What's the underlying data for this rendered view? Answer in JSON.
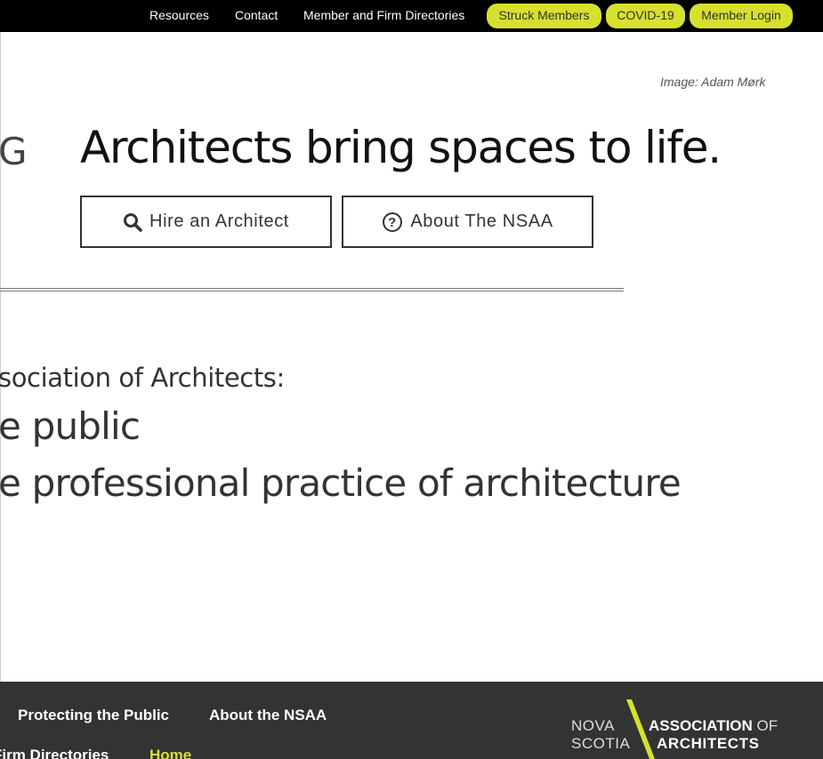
{
  "top_nav": {
    "links": [
      "Resources",
      "Contact",
      "Member and Firm Directories"
    ],
    "pills": [
      "Struck Members",
      "COVID-19",
      "Member Login"
    ]
  },
  "hero": {
    "image_credit": "Image: Adam Mørk",
    "clipped_letter": "G",
    "headline": "Architects bring spaces to life.",
    "buttons": {
      "hire": "Hire an Architect",
      "about": "About The NSAA"
    }
  },
  "mission": {
    "intro": "sociation of Architects:",
    "line1": "e public",
    "line2": "e professional practice of architecture"
  },
  "footer": {
    "nav_row1": [
      "Protecting the Public",
      "About the NSAA"
    ],
    "nav_row2": [
      "Firm Directories",
      "Home"
    ],
    "logo": {
      "nova": "NOVA",
      "scotia": "SCOTIA",
      "association": "ASSOCIATION",
      "of": "OF",
      "architects": "ARCHITECTS"
    }
  },
  "colors": {
    "accent": "#d6e02e",
    "topbar": "#000000",
    "footer": "#333333"
  },
  "icons": [
    "search-icon",
    "question-circle-icon"
  ]
}
